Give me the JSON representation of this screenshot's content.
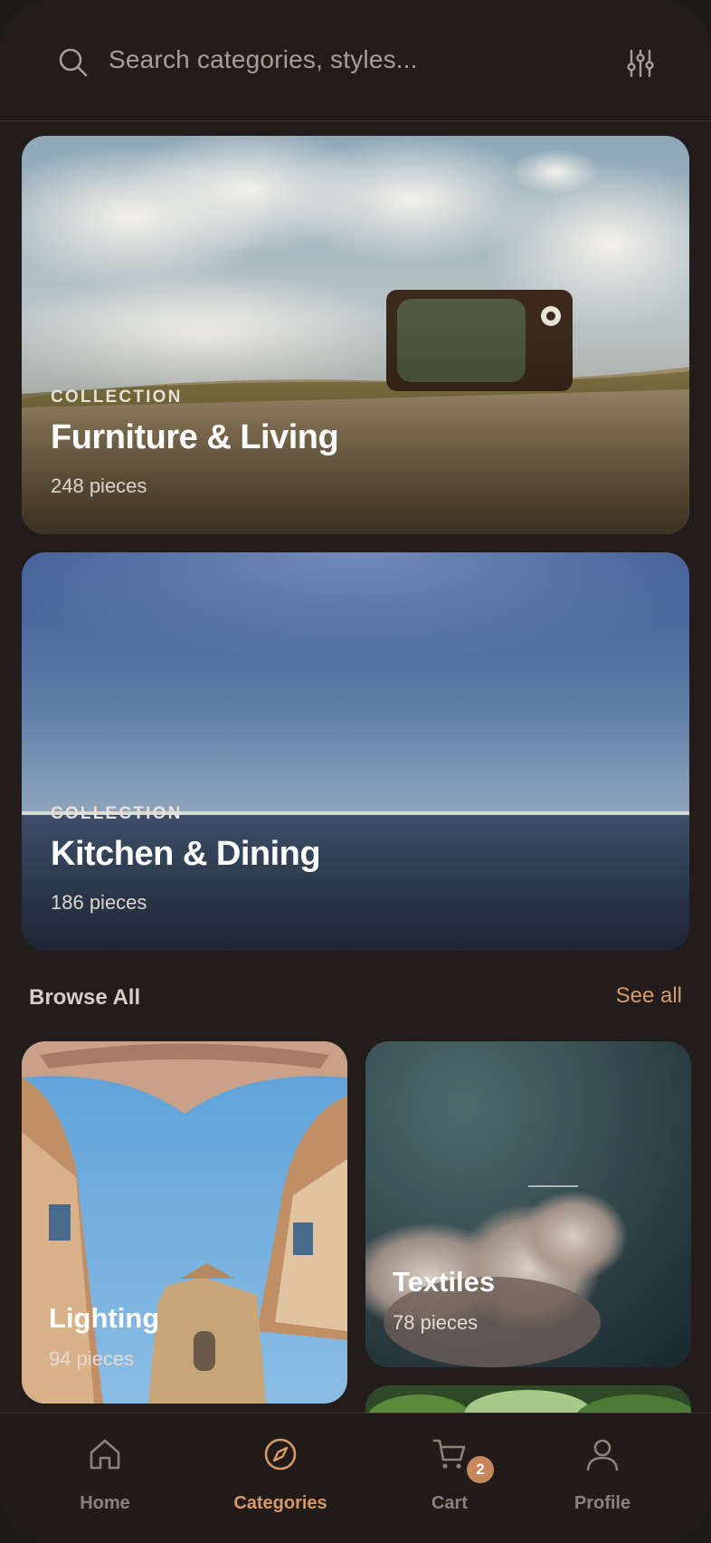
{
  "search": {
    "placeholder": "Search categories, styles...",
    "icon": "search-icon",
    "filter_icon": "sliders-icon"
  },
  "featured": [
    {
      "overline": "COLLECTION",
      "title": "Furniture & Living",
      "count": "248 pieces"
    },
    {
      "overline": "COLLECTION",
      "title": "Kitchen & Dining",
      "count": "186 pieces"
    }
  ],
  "browse": {
    "title": "Browse All",
    "see_all": "See all",
    "tiles": [
      {
        "title": "Lighting",
        "count": "94 pieces"
      },
      {
        "title": "Textiles",
        "count": "78 pieces"
      }
    ]
  },
  "nav": {
    "items": [
      {
        "label": "Home",
        "icon": "home-icon"
      },
      {
        "label": "Categories",
        "icon": "compass-icon"
      },
      {
        "label": "Cart",
        "icon": "cart-icon",
        "badge": "2"
      },
      {
        "label": "Profile",
        "icon": "user-icon"
      }
    ],
    "active": "Categories"
  },
  "colors": {
    "background": "#221d1a",
    "accent": "#d69a6a",
    "badge": "#c8875a",
    "muted": "#8a837c"
  }
}
